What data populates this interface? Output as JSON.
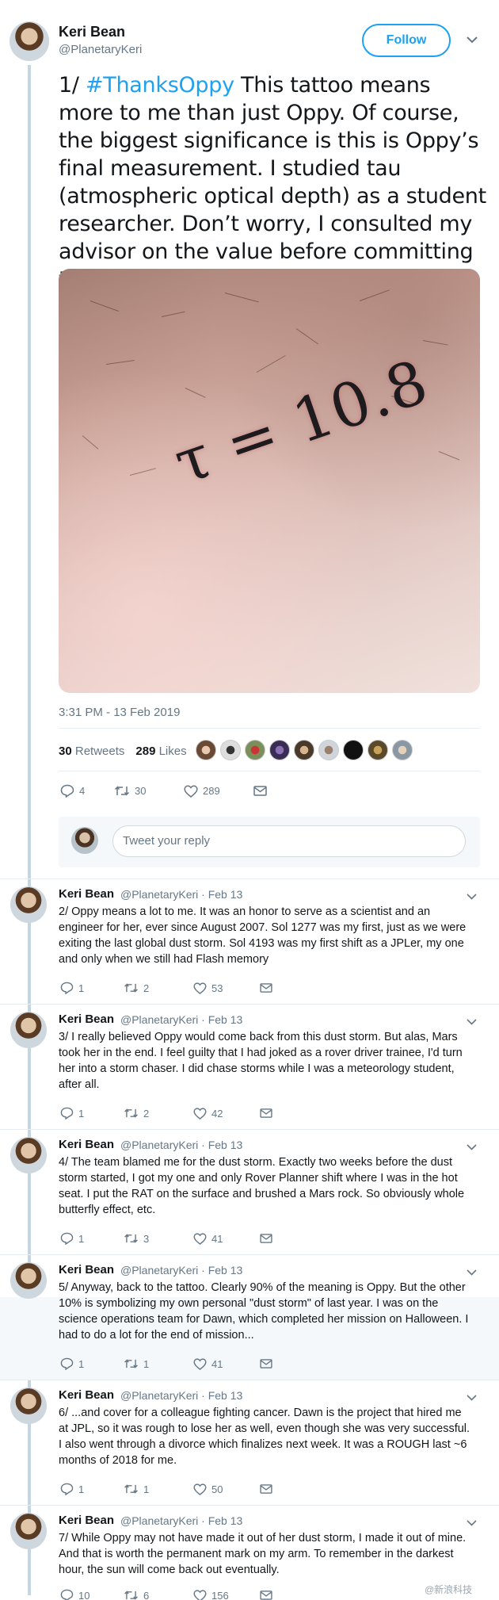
{
  "main_tweet": {
    "author_name": "Keri Bean",
    "author_handle": "@PlanetaryKeri",
    "follow_label": "Follow",
    "text_prefix": "1/ ",
    "hashtag": "#ThanksOppy",
    "text_body": " This tattoo means more to me than just Oppy. Of course, the biggest significance is this is Oppy’s final measurement. I studied tau (atmospheric optical depth) as a student researcher. Don’t worry, I consulted my advisor on the value before committing to the ink",
    "tattoo_text": "τ = 10.8",
    "timestamp": "3:31 PM - 13 Feb 2019",
    "retweets_count": "30",
    "retweets_label": "Retweets",
    "likes_count": "289",
    "likes_label": "Likes",
    "reply_count": "4",
    "retweet_count_action": "30",
    "like_count_action": "289",
    "reply_placeholder": "Tweet your reply"
  },
  "replies": [
    {
      "name": "Keri Bean",
      "handle": "@PlanetaryKeri · Feb 13",
      "text": "2/ Oppy means a lot to me. It was an honor to serve as a scientist and an engineer for her, ever since August 2007. Sol 1277 was my first, just as we were exiting the last global dust storm. Sol 4193 was my first shift as a JPLer, my one and only when we still had Flash memory",
      "replies": "1",
      "retweets": "2",
      "likes": "53"
    },
    {
      "name": "Keri Bean",
      "handle": "@PlanetaryKeri · Feb 13",
      "text": "3/ I really believed Oppy would come back from this dust storm. But alas, Mars took her in the end. I feel guilty that I had joked as a rover driver trainee, I'd turn her into a storm chaser. I did chase storms while I was a meteorology student, after all.",
      "replies": "1",
      "retweets": "2",
      "likes": "42"
    },
    {
      "name": "Keri Bean",
      "handle": "@PlanetaryKeri · Feb 13",
      "text": "4/ The team blamed me for the dust storm. Exactly two weeks before the dust storm started, I got my one and only Rover Planner shift where I was in the hot seat. I put the RAT on the surface and brushed a Mars rock. So obviously whole butterfly effect, etc.",
      "replies": "1",
      "retweets": "3",
      "likes": "41"
    },
    {
      "name": "Keri Bean",
      "handle": "@PlanetaryKeri · Feb 13",
      "text": "5/ Anyway, back to the tattoo. Clearly 90% of the meaning is Oppy. But the other 10% is symbolizing my own personal \"dust storm\" of last year. I was on the science operations team for Dawn, which completed her mission on Halloween. I had to do a lot for the end of mission...",
      "replies": "1",
      "retweets": "1",
      "likes": "41"
    },
    {
      "name": "Keri Bean",
      "handle": "@PlanetaryKeri · Feb 13",
      "text": "6/ ...and cover for a colleague fighting cancer. Dawn is the project that hired me at JPL, so it was rough to lose her as well, even though she was very successful. I also went through a divorce which finalizes next week. It was a ROUGH last ~6 months of 2018 for me.",
      "replies": "1",
      "retweets": "1",
      "likes": "50"
    },
    {
      "name": "Keri Bean",
      "handle": "@PlanetaryKeri · Feb 13",
      "text": "7/ While Oppy may not have made it out of her dust storm, I made it out of mine. And that is worth the permanent mark on my arm. To remember in the darkest hour, the sun will come back out eventually.",
      "replies": "10",
      "retweets": "6",
      "likes": "156"
    }
  ],
  "watermark": "@新浪科技",
  "icons": [
    "reply-icon",
    "retweet-icon",
    "like-icon",
    "message-icon",
    "chevron-down-icon"
  ],
  "colors": {
    "accent": "#1da1f2",
    "thread_line": "#c4d6e2",
    "muted": "#657786"
  }
}
